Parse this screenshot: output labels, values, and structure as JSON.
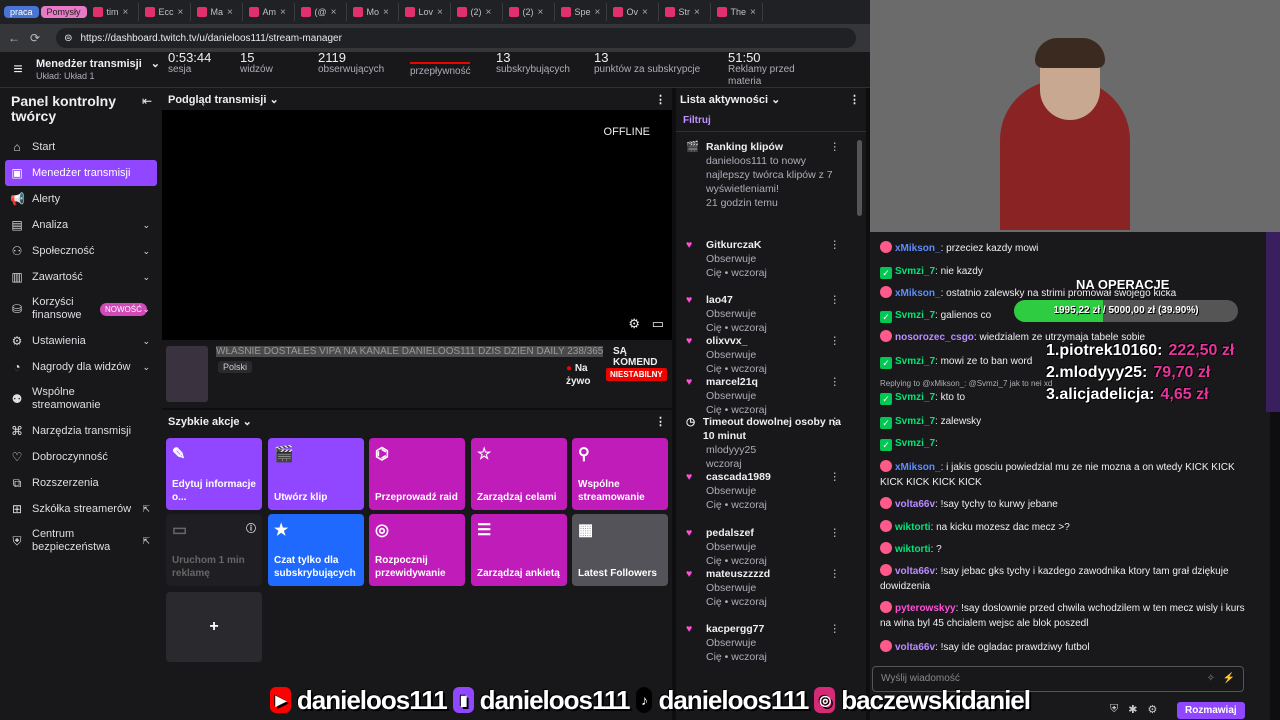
{
  "tabs": [
    {
      "label": "praca",
      "kind": "group-blue"
    },
    {
      "label": "Pomysły",
      "kind": "group-pink"
    },
    {
      "label": "tim",
      "kind": "tab"
    },
    {
      "label": "Ecc",
      "kind": "tab"
    },
    {
      "label": "Ma",
      "kind": "tab"
    },
    {
      "label": "Am",
      "kind": "tab"
    },
    {
      "label": "(@",
      "kind": "tab"
    },
    {
      "label": "Mo",
      "kind": "tab"
    },
    {
      "label": "Lov",
      "kind": "tab"
    },
    {
      "label": "(2)",
      "kind": "tab"
    },
    {
      "label": "(2)",
      "kind": "tab"
    },
    {
      "label": "Spe",
      "kind": "tab"
    },
    {
      "label": "Ov",
      "kind": "tab"
    },
    {
      "label": "Str",
      "kind": "tab"
    },
    {
      "label": "The",
      "kind": "tab"
    }
  ],
  "address": {
    "url": "https://dashboard.twitch.tv/u/danieloos111/stream-manager"
  },
  "header": {
    "title": "Menedżer transmisji",
    "layout": "Układ: Układ 1",
    "stats": [
      {
        "value": "0:53:44",
        "label": "sesja"
      },
      {
        "value": "15",
        "label": "widzów"
      },
      {
        "value": "2119",
        "label": "obserwujących"
      },
      {
        "value": "",
        "label": "przepływność"
      },
      {
        "value": "13",
        "label": "subskrybujących"
      },
      {
        "value": "13",
        "label": "punktów za subskrypcje"
      },
      {
        "value": "51:50",
        "label": "Reklamy przed materia"
      }
    ]
  },
  "sidebar": {
    "title": "Panel kontrolny twórcy",
    "items": [
      {
        "label": "Start",
        "icon": "home-icon"
      },
      {
        "label": "Menedżer transmisji",
        "icon": "stream-manager-icon",
        "active": true
      },
      {
        "label": "Alerty",
        "icon": "megaphone-icon"
      },
      {
        "label": "Analiza",
        "icon": "analytics-icon",
        "chevron": true
      },
      {
        "label": "Społeczność",
        "icon": "community-icon",
        "chevron": true
      },
      {
        "label": "Zawartość",
        "icon": "content-icon",
        "chevron": true
      },
      {
        "label": "Korzyści finansowe",
        "icon": "monetization-icon",
        "chevron": true,
        "badge": "NOWOŚĆ"
      },
      {
        "label": "Ustawienia",
        "icon": "settings-icon",
        "chevron": true
      },
      {
        "label": "Nagrody dla widzów",
        "icon": "rewards-icon",
        "chevron": true
      },
      {
        "label": "Wspólne streamowanie",
        "icon": "collab-icon"
      },
      {
        "label": "Narzędzia transmisji",
        "icon": "tools-icon"
      },
      {
        "label": "Dobroczynność",
        "icon": "charity-icon"
      },
      {
        "label": "Rozszerzenia",
        "icon": "extensions-icon"
      },
      {
        "label": "Szkółka streamerów",
        "icon": "school-icon",
        "external": true
      },
      {
        "label": "Centrum bezpieczeństwa",
        "icon": "shield-icon",
        "external": true
      }
    ]
  },
  "preview": {
    "title": "Podgląd transmisji",
    "status": "OFFLINE",
    "stream_title": "WŁAŚNIE DOSTAŁEŚ VIPA NA KANALE DANIELOOS111 DZIŚ DZIEN DAILY 238/365",
    "stream_suffix": "SĄ KOMEND",
    "language": "Polski",
    "live_label": "Na żywo",
    "unstable_label": "NIESTABILNY"
  },
  "quick_actions": {
    "title": "Szybkie akcje",
    "tiles": [
      {
        "label": "Edytuj informacje o...",
        "icon": "pencil-icon",
        "color": "#9147ff"
      },
      {
        "label": "Utwórz klip",
        "icon": "clapper-icon",
        "color": "#9147ff"
      },
      {
        "label": "Przeprowadź raid",
        "icon": "parachute-icon",
        "color": "#bf1cb9"
      },
      {
        "label": "Zarządzaj celami",
        "icon": "star-outline-icon",
        "color": "#bf1cb9"
      },
      {
        "label": "Wspólne streamowanie",
        "icon": "add-user-icon",
        "color": "#bf1cb9"
      },
      {
        "label": "Uruchom 1 min reklamę",
        "icon": "ad-icon",
        "color": "#1f1f23",
        "disabled": true
      },
      {
        "label": "Czat tylko dla subskrybujących",
        "icon": "star-icon",
        "color": "#1f69ff"
      },
      {
        "label": "Rozpocznij przewidywanie",
        "icon": "prediction-icon",
        "color": "#bf1cb9"
      },
      {
        "label": "Zarządzaj ankietą",
        "icon": "poll-icon",
        "color": "#bf1cb9"
      },
      {
        "label": "Latest Followers",
        "icon": "followers-icon",
        "color": "#535359"
      },
      {
        "label": "+",
        "icon": "plus-icon",
        "color": "#2a2a2e"
      }
    ]
  },
  "activity": {
    "title": "Lista aktywności",
    "filter": "Filtruj",
    "items": [
      {
        "title": "Ranking klipów",
        "body": "danieloos111 to nowy najlepszy twórca klipów z 7 wyświetleniami!",
        "meta": "21 godzin temu",
        "icon": "clapper-gold-icon"
      },
      {
        "title": "GitkurczaK",
        "body": "Obserwuje",
        "meta": "Cię • wczoraj",
        "icon": "heart-icon"
      },
      {
        "title": "lao47",
        "body": "Obserwuje",
        "meta": "Cię • wczoraj",
        "icon": "heart-icon"
      },
      {
        "title": "olixvvx_",
        "body": "Obserwuje",
        "meta": "Cię • wczoraj",
        "icon": "heart-icon"
      },
      {
        "title": "marcel21q",
        "body": "Obserwuje",
        "meta": "Cię • wczoraj",
        "icon": "heart-icon"
      },
      {
        "title": "Timeout dowolnej osoby na 10 minut",
        "body": "mlodyyy25",
        "meta": "wczoraj",
        "icon": "clock-icon"
      },
      {
        "title": "cascada1989",
        "body": "Obserwuje",
        "meta": "Cię • wczoraj",
        "icon": "heart-icon"
      },
      {
        "title": "pedalszef",
        "body": "Obserwuje",
        "meta": "Cię • wczoraj",
        "icon": "heart-icon"
      },
      {
        "title": "mateuszzzzd",
        "body": "Obserwuje",
        "meta": "Cię • wczoraj",
        "icon": "heart-icon"
      },
      {
        "title": "kacpergg77",
        "body": "Obserwuje",
        "meta": "Cię • wczoraj",
        "icon": "heart-icon"
      }
    ]
  },
  "overlay": {
    "operation_title": "NA OPERACJE",
    "goal_text": "1995,22 zł / 5000,00 zł (39.90%)",
    "goal_fraction": 0.399,
    "leaders": [
      {
        "rank": "1.",
        "name": "piotrek10160:",
        "amount": "222,50 zł"
      },
      {
        "rank": "2.",
        "name": "mlodyyy25:",
        "amount": "79,70 zł"
      },
      {
        "rank": "3.",
        "name": "alicjadelicja:",
        "amount": "4,65 zł"
      }
    ]
  },
  "chat": {
    "messages": [
      {
        "user": "xMikson_",
        "color": "#5c8dff",
        "text": "przeciez kazdy mowi"
      },
      {
        "user": "Svmzi_7",
        "color": "#00e676",
        "text": "nie kazdy"
      },
      {
        "user": "xMikson_",
        "color": "#5c8dff",
        "text": "ostatnio zalewsky na strimi promował swojego kicka"
      },
      {
        "user": "Svmzi_7",
        "color": "#00e676",
        "text": "galienos co"
      },
      {
        "user": "nosorozec_csgo",
        "color": "#b98cff",
        "text": "wiedzialem ze utrzymaja tabele sobie"
      },
      {
        "user": "Svmzi_7",
        "color": "#00e676",
        "text": "mowi ze to ban word"
      },
      {
        "user": "Svmzi_7",
        "color": "#00e676",
        "text": "kto to",
        "reply": "Replying to @xMikson_: @Svmzi_7 jak to nei xd"
      },
      {
        "user": "Svmzi_7",
        "color": "#00e676",
        "text": "zalewsky"
      },
      {
        "user": "Svmzi_7",
        "color": "#00e676",
        "text": ""
      },
      {
        "user": "xMikson_",
        "color": "#5c8dff",
        "text": "i jakis gosciu powiedzial mu ze nie mozna a on wtedy KICK KICK KICK KICK KICK KICK"
      },
      {
        "user": "volta66v",
        "color": "#b98cff",
        "text": "!say tychy to kurwy jebane"
      },
      {
        "user": "wiktorti",
        "color": "#00e676",
        "text": "na kicku mozesz dac mecz >?"
      },
      {
        "user": "wiktorti",
        "color": "#00e676",
        "text": "?"
      },
      {
        "user": "volta66v",
        "color": "#b98cff",
        "text": "!say jebac gks tychy i kazdego zawodnika ktory tam grał dziękuje dowidzenia"
      },
      {
        "user": "pyterowskyy",
        "color": "#ff4fd8",
        "text": "!say doslownie przed chwila wchodzilem w ten mecz wisly i kurs na wina byl 45 chcialem wejsc ale blok poszedl"
      },
      {
        "user": "volta66v",
        "color": "#b98cff",
        "text": "!say ide ogladac prawdziwy futbol"
      }
    ],
    "input_placeholder": "Wyślij wiadomość",
    "send_label": "Rozmawiaj"
  },
  "banner": {
    "youtube": "danieloos111",
    "twitch": "danieloos111",
    "tiktok": "danieloos111",
    "instagram": "baczewskidaniel"
  }
}
